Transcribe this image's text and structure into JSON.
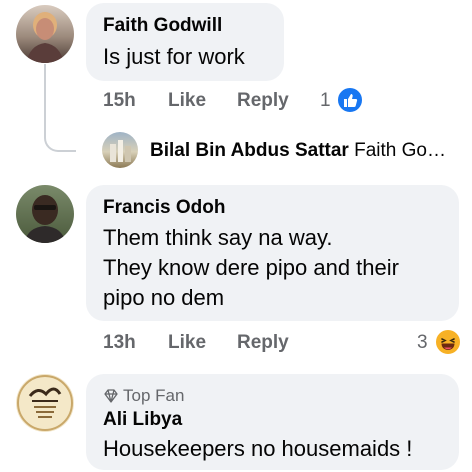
{
  "comments": [
    {
      "author": "Faith Godwill",
      "text": "Is just for work",
      "time": "15h",
      "like_label": "Like",
      "reply_label": "Reply",
      "reaction_count": "1",
      "reaction_icon": "like-icon",
      "reaction_color": "#1877f2"
    },
    {
      "author": "Francis Odoh",
      "text_lines": [
        "Them think say na way.",
        "They know dere pipo and their",
        "pipo no dem"
      ],
      "time": "13h",
      "like_label": "Like",
      "reply_label": "Reply",
      "reaction_count": "3",
      "reaction_icon": "haha-emoji-icon",
      "reaction_color": "#f7b125"
    },
    {
      "badge": "Top Fan",
      "author": "Ali Libya",
      "text": "Housekeepers no housemaids !"
    }
  ],
  "reply_preview": {
    "author": "Bilal Bin Abdus Sattar",
    "snippet": "Faith Go…"
  }
}
